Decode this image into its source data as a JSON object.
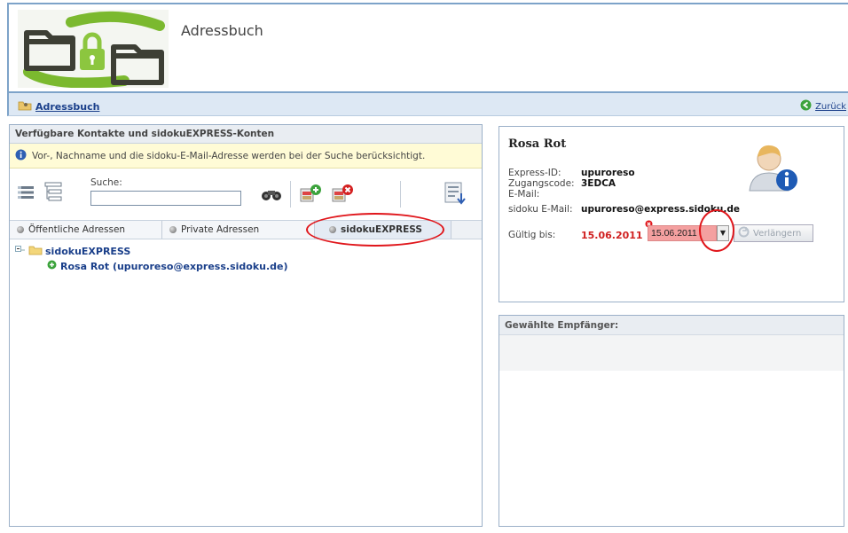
{
  "app": {
    "title": "Adressbuch"
  },
  "nav": {
    "breadcrumb": "Adressbuch",
    "back": "Zurück"
  },
  "contacts": {
    "panel_title": "Verfügbare Kontakte und sidokuEXPRESS-Konten",
    "info_text": "Vor-, Nachname und die sidoku-E-Mail-Adresse werden bei der Suche berücksichtigt.",
    "search_label": "Suche:",
    "search_value": "",
    "tabs": [
      {
        "label": "Öffentliche Adressen"
      },
      {
        "label": "Private Adressen"
      },
      {
        "label": "sidokuEXPRESS"
      }
    ],
    "tree": {
      "root": "sidokuEXPRESS",
      "items": [
        {
          "label": "Rosa Rot (upuroreso@express.sidoku.de)"
        }
      ]
    }
  },
  "detail": {
    "name": "Rosa Rot",
    "rows": [
      {
        "label": "Express-ID:",
        "value": "upuroreso"
      },
      {
        "label": "Zugangscode:",
        "value": "3EDCA"
      },
      {
        "label": "E-Mail:",
        "value": ""
      }
    ],
    "sidoku_email_label": "sidoku E-Mail:",
    "sidoku_email_value": "upuroreso@express.sidoku.de",
    "valid_label": "Gültig bis:",
    "valid_value": "15.06.2011",
    "date_input": "15.06.2011",
    "extend_button": "Verlängern"
  },
  "recipients": {
    "title": "Gewählte Empfänger:"
  },
  "colors": {
    "accent": "#1a3f8a",
    "highlight": "#e0161b",
    "warning_bg": "#fffbd6"
  }
}
